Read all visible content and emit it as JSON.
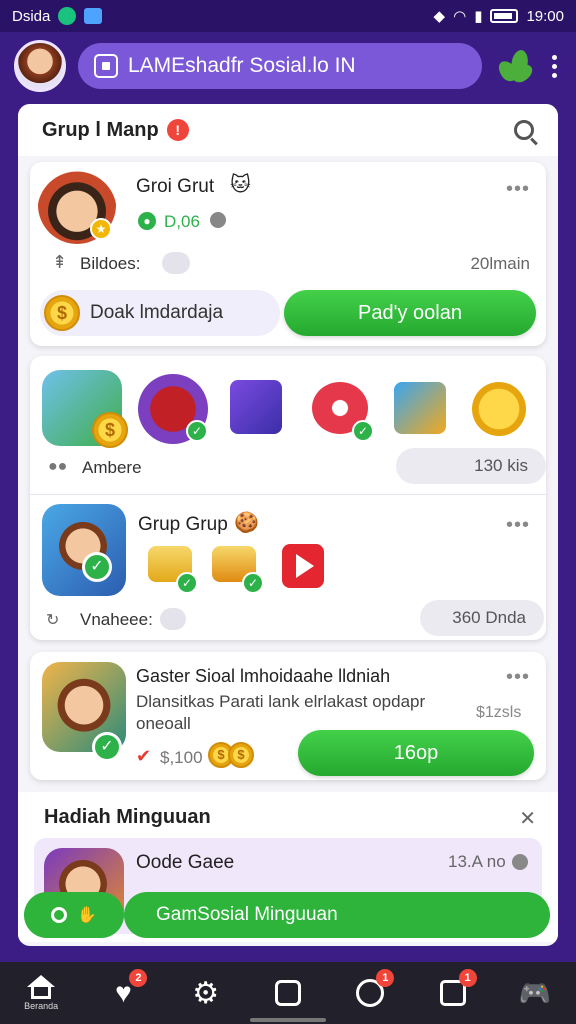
{
  "status_bar": {
    "left_text": "Dsida",
    "time": "19:00"
  },
  "header": {
    "title": "LAMEshadfr Sosial.lo IN"
  },
  "panel": {
    "title": "Grup l Manp"
  },
  "group_card": {
    "name": "Groi Grut",
    "points": "D,06",
    "members_label": "Bildoes:",
    "time": "20lmain",
    "left_button": "Doak lmdardaja",
    "right_button": "Pad'y oolan"
  },
  "items_card": {
    "label": "Ambere",
    "count": "130 kis"
  },
  "grup_card": {
    "title": "Grup Grup",
    "label": "Vnaheee:",
    "count": "360 Dnda"
  },
  "promo_card": {
    "title": "Gaster Sioal lmhoidaahe lldniah",
    "desc_line1": "Dlansitkas Parati lank elrlakast opdapr",
    "desc_line2": "oneoall",
    "side_value": "$1zsls",
    "price": "$,100",
    "button": "16op"
  },
  "weekly_section": {
    "title": "Hadiah Minguuan",
    "item_title": "Oode Gaee",
    "item_time": "13.A no"
  },
  "fab": {
    "label": "GamSosial Minguuan"
  },
  "bottom_nav": {
    "home_label": "Beranda",
    "badges": [
      "2",
      "1",
      "1"
    ]
  },
  "colors": {
    "background": "#3c1d86",
    "accent_green": "#2eb33b",
    "pill_purple": "#7b58d8",
    "badge_red": "#f0453a"
  }
}
